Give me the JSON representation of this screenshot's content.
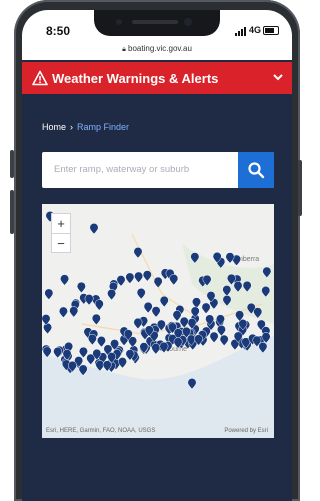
{
  "status_bar": {
    "time": "8:50",
    "network": "4G"
  },
  "browser": {
    "url": "boating.vic.gov.au"
  },
  "alert_banner": {
    "title": "Weather Warnings & Alerts"
  },
  "breadcrumb": {
    "home": "Home",
    "current": "Ramp Finder"
  },
  "search": {
    "placeholder": "Enter ramp, waterway or suburb"
  },
  "map": {
    "zoom_in": "+",
    "zoom_out": "−",
    "city_label_1": "Canberra",
    "city_label_2": "Melbourne",
    "attribution": "Esri, HERE, Garmin, FAO, NOAA, USGS",
    "powered_by": "Powered by Esri"
  },
  "colors": {
    "alert": "#d9222a",
    "navy": "#1f2a44",
    "link": "#7fb2ff",
    "search_button": "#1d6fd6",
    "pin": "#1a3a7a"
  },
  "icons": [
    "warning-icon",
    "chevron-down-icon",
    "search-icon",
    "map-pin-icon"
  ]
}
